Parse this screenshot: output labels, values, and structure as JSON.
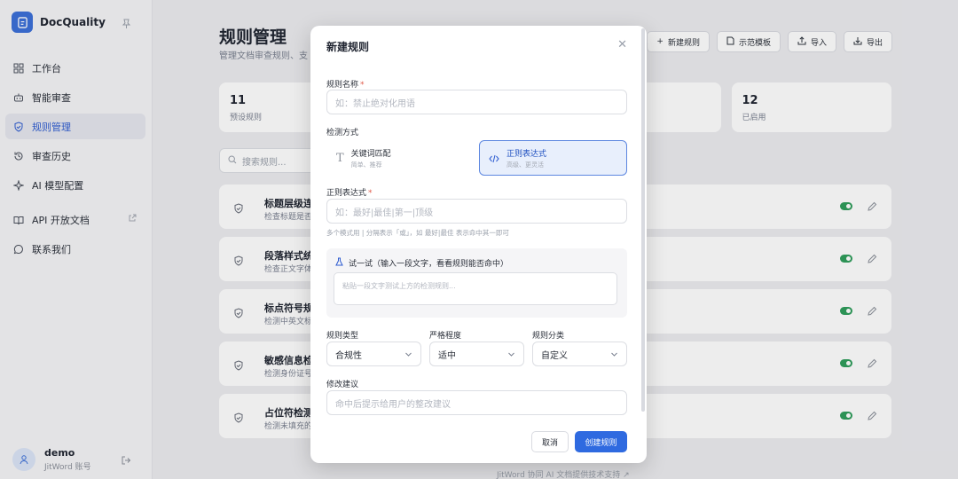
{
  "app": {
    "name": "DocQuality"
  },
  "sidebar": {
    "items": [
      {
        "label": "工作台",
        "icon": "dashboard-icon"
      },
      {
        "label": "智能审查",
        "icon": "robot-icon"
      },
      {
        "label": "规则管理",
        "icon": "shield-icon",
        "active": true
      },
      {
        "label": "审查历史",
        "icon": "history-icon"
      },
      {
        "label": "AI 模型配置",
        "icon": "sparkle-icon"
      },
      {
        "label": "API 开放文档",
        "icon": "book-icon",
        "external": true
      },
      {
        "label": "联系我们",
        "icon": "chat-icon"
      }
    ],
    "user": {
      "name": "demo",
      "sub": "JitWord 账号"
    }
  },
  "page": {
    "title": "规则管理",
    "subtitle": "管理文档审查规则、支",
    "toolbar": [
      "新建规则",
      "示范模板",
      "导入",
      "导出"
    ],
    "stats": [
      {
        "value": "11",
        "label": "预设规则"
      },
      {
        "value": "12",
        "label": "已启用"
      }
    ],
    "search_placeholder": "搜索规则...",
    "rules": [
      {
        "title": "标题层级连",
        "desc": "检查标题是否"
      },
      {
        "title": "段落样式统",
        "desc": "检查正文字体"
      },
      {
        "title": "标点符号规",
        "desc": "检测中英文标"
      },
      {
        "title": "敏感信息检",
        "desc": "检测身份证号"
      },
      {
        "title": "占位符检测",
        "desc": "检测未填充的"
      }
    ],
    "footer": "JitWord 协同 AI 文档提供技术支持"
  },
  "modal": {
    "title": "新建规则",
    "name_label": "规则名称",
    "name_placeholder": "如：禁止绝对化用语",
    "method_label": "检测方式",
    "methods": [
      {
        "name": "关键词匹配",
        "desc": "简单、推荐"
      },
      {
        "name": "正则表达式",
        "desc": "高级、更灵活",
        "selected": true
      }
    ],
    "regex_label": "正则表达式",
    "regex_placeholder": "如：最好|最佳|第一|顶级",
    "regex_hint": "多个模式用 | 分隔表示「或」，如 最好|最佳 表示命中其一即可",
    "try_title": "试一试（输入一段文字，看看规则能否命中）",
    "try_placeholder": "粘贴一段文字测试上方的检测规则...",
    "type_label": "规则类型",
    "type_value": "合规性",
    "severity_label": "严格程度",
    "severity_value": "适中",
    "category_label": "规则分类",
    "category_value": "自定义",
    "suggest_label": "修改建议",
    "suggest_placeholder": "命中后提示给用户的整改建议",
    "cancel": "取消",
    "create": "创建规则"
  }
}
